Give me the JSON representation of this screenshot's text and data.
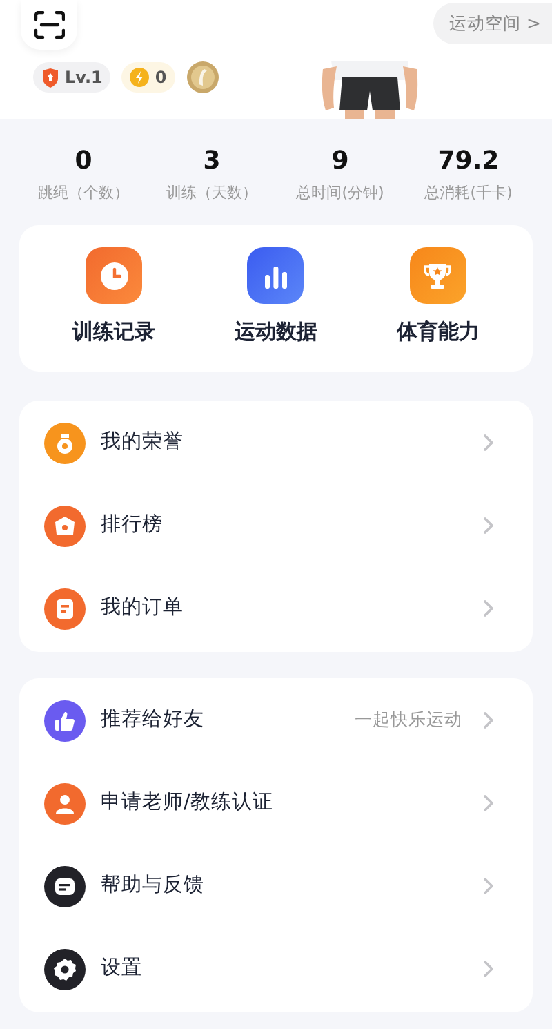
{
  "header": {
    "space_link": "运动空间 >",
    "level_badge": "Lv.1",
    "points_badge": "0"
  },
  "stats": [
    {
      "value": "0",
      "label": "跳绳（个数）"
    },
    {
      "value": "3",
      "label": "训练（天数）"
    },
    {
      "value": "9",
      "label": "总时间(分钟)"
    },
    {
      "value": "79.2",
      "label": "总消耗(千卡)"
    }
  ],
  "shortcuts": [
    {
      "label": "训练记录"
    },
    {
      "label": "运动数据"
    },
    {
      "label": "体育能力"
    }
  ],
  "menu_groups": [
    [
      {
        "label": "我的荣誉"
      },
      {
        "label": "排行榜"
      },
      {
        "label": "我的订单"
      }
    ],
    [
      {
        "label": "推荐给好友",
        "hint": "一起快乐运动"
      },
      {
        "label": "申请老师/教练认证"
      },
      {
        "label": "帮助与反馈"
      },
      {
        "label": "设置"
      }
    ]
  ]
}
